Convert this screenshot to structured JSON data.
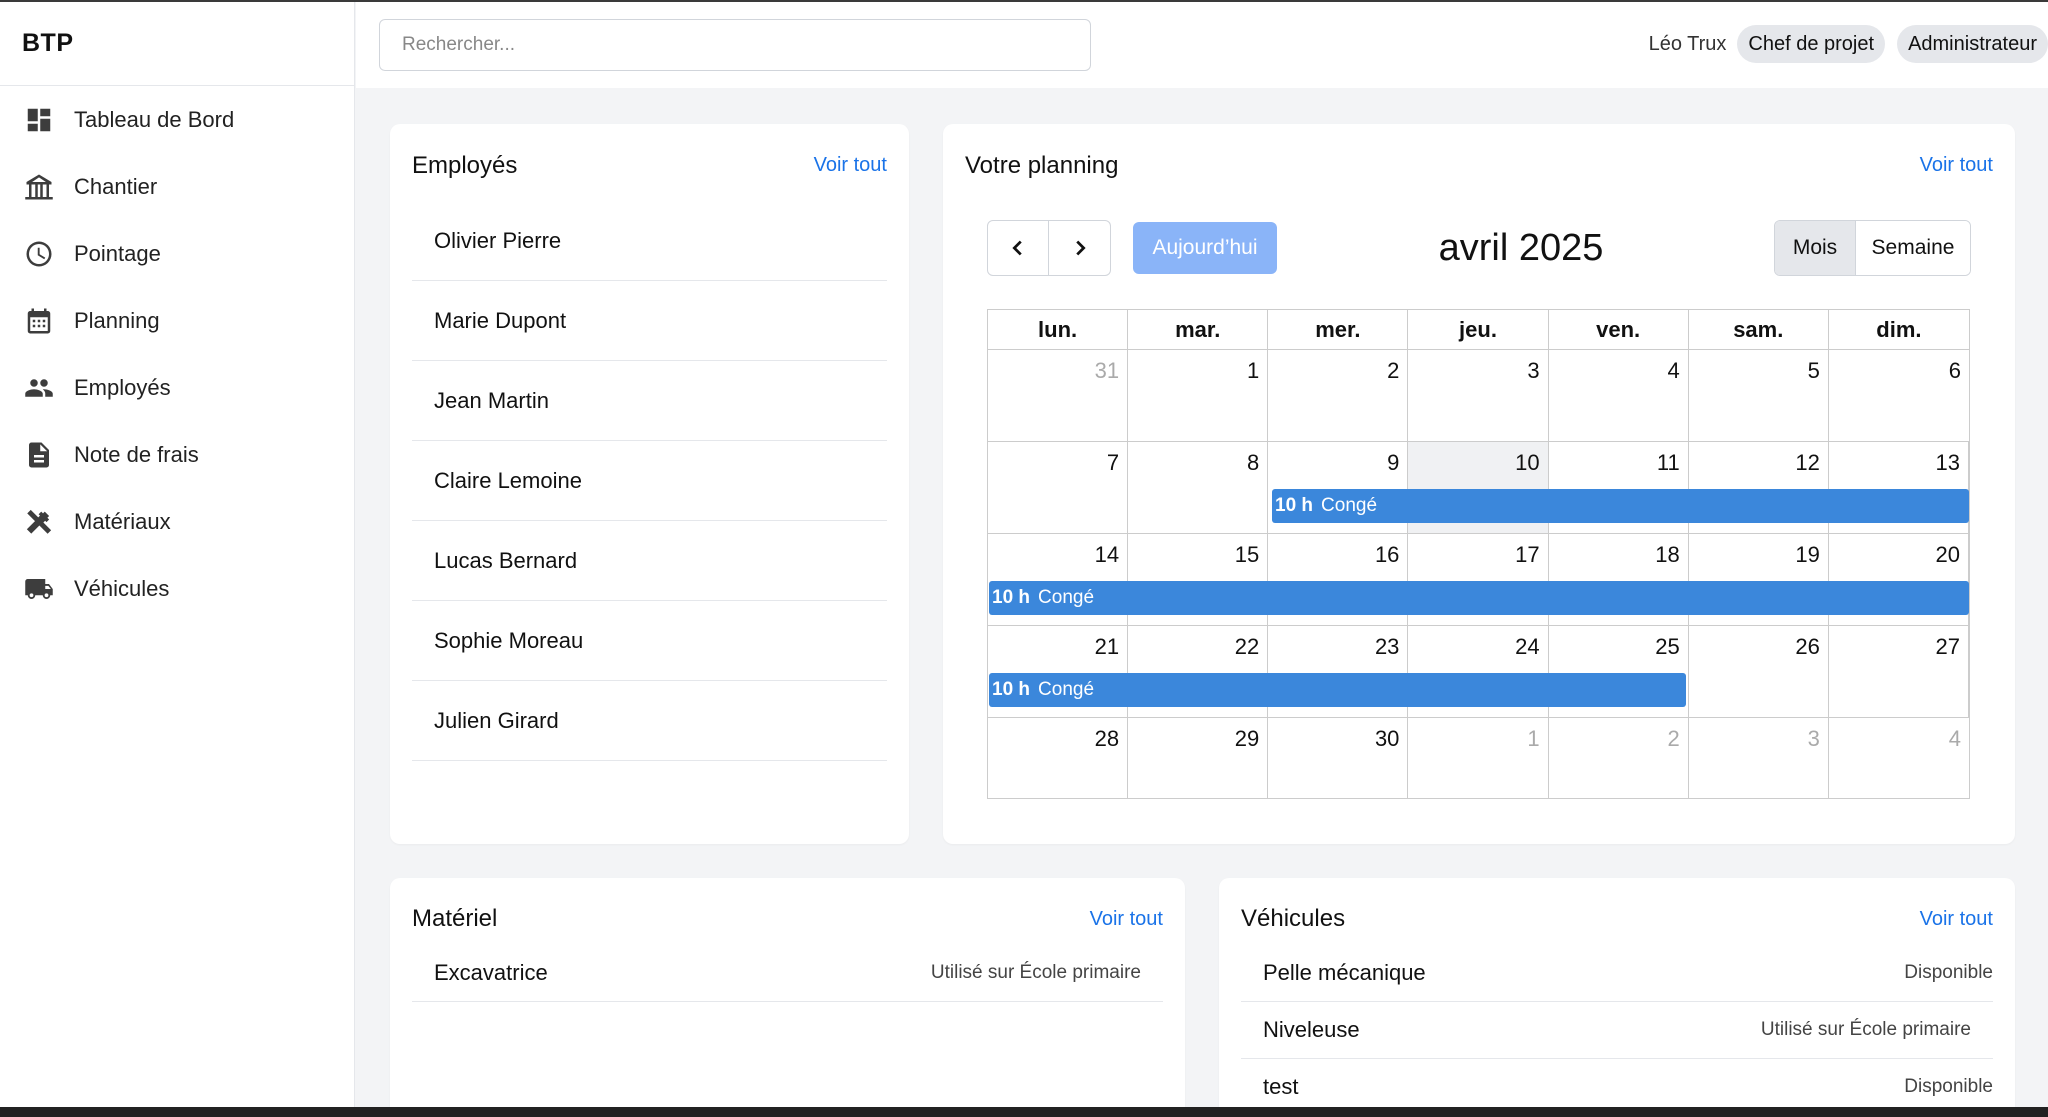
{
  "brand": "BTP",
  "sidebar": {
    "items": [
      {
        "label": "Tableau de Bord",
        "icon": "dashboard-icon"
      },
      {
        "label": "Chantier",
        "icon": "construction-icon"
      },
      {
        "label": "Pointage",
        "icon": "clock-icon"
      },
      {
        "label": "Planning",
        "icon": "calendar-icon"
      },
      {
        "label": "Employés",
        "icon": "people-icon"
      },
      {
        "label": "Note de frais",
        "icon": "document-icon"
      },
      {
        "label": "Matériaux",
        "icon": "tools-icon"
      },
      {
        "label": "Véhicules",
        "icon": "truck-icon"
      }
    ]
  },
  "header": {
    "search_placeholder": "Rechercher...",
    "user_name": "Léo Trux",
    "roles": [
      "Chef de projet",
      "Administrateur"
    ]
  },
  "employees": {
    "title": "Employés",
    "see_all": "Voir tout",
    "list": [
      "Olivier Pierre",
      "Marie Dupont",
      "Jean Martin",
      "Claire Lemoine",
      "Lucas Bernard",
      "Sophie Moreau",
      "Julien Girard"
    ]
  },
  "planning": {
    "title": "Votre planning",
    "see_all": "Voir tout",
    "today_label": "Aujourd’hui",
    "month_label": "avril 2025",
    "view_month": "Mois",
    "view_week": "Semaine",
    "weekdays": [
      "lun.",
      "mar.",
      "mer.",
      "jeu.",
      "ven.",
      "sam.",
      "dim."
    ],
    "weeks": [
      [
        "31",
        "1",
        "2",
        "3",
        "4",
        "5",
        "6"
      ],
      [
        "7",
        "8",
        "9",
        "10",
        "11",
        "12",
        "13"
      ],
      [
        "14",
        "15",
        "16",
        "17",
        "18",
        "19",
        "20"
      ],
      [
        "21",
        "22",
        "23",
        "24",
        "25",
        "26",
        "27"
      ],
      [
        "28",
        "29",
        "30",
        "1",
        "2",
        "3",
        "4"
      ]
    ],
    "events": [
      {
        "time": "10 h",
        "title": "Congé"
      },
      {
        "time": "10 h",
        "title": "Congé"
      },
      {
        "time": "10 h",
        "title": "Congé"
      }
    ],
    "event_color": "#3b87db"
  },
  "materiel": {
    "title": "Matériel",
    "see_all": "Voir tout",
    "rows": [
      {
        "name": "Excavatrice",
        "status": "Utilisé sur École primaire"
      }
    ]
  },
  "vehicules": {
    "title": "Véhicules",
    "see_all": "Voir tout",
    "rows": [
      {
        "name": "Pelle mécanique",
        "status": "Disponible"
      },
      {
        "name": "Niveleuse",
        "status": "Utilisé sur École primaire"
      },
      {
        "name": "test",
        "status": "Disponible"
      }
    ]
  },
  "colors": {
    "accent": "#1a73e8",
    "today_button": "#8ab4f8"
  }
}
